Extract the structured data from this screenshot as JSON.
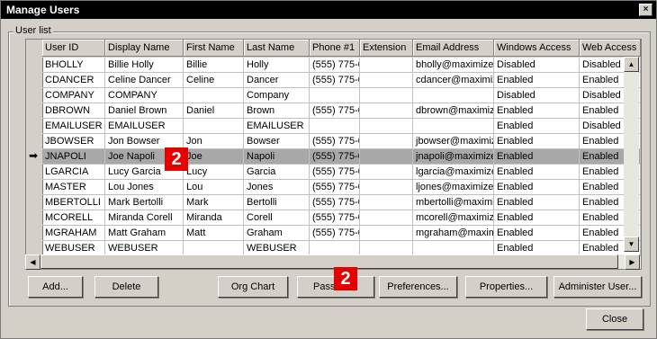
{
  "window": {
    "title": "Manage Users",
    "close_glyph": "×"
  },
  "group": {
    "label": "User list"
  },
  "grid": {
    "columns": [
      "User ID",
      "Display Name",
      "First Name",
      "Last Name",
      "Phone #1",
      "Extension",
      "Email Address",
      "Windows Access",
      "Web Access"
    ],
    "sort_indicator": "/",
    "rows": [
      [
        "BHOLLY",
        "Billie Holly",
        "Billie",
        "Holly",
        "(555) 775-0",
        "",
        "bholly@maximizer.c",
        "Disabled",
        "Disabled"
      ],
      [
        "CDANCER",
        "Celine Dancer",
        "Celine",
        "Dancer",
        "(555) 775-0",
        "",
        "cdancer@maximize",
        "Enabled",
        "Enabled"
      ],
      [
        "COMPANY",
        "COMPANY",
        "",
        "Company",
        "",
        "",
        "",
        "Disabled",
        "Disabled"
      ],
      [
        "DBROWN",
        "Daniel Brown",
        "Daniel",
        "Brown",
        "(555) 775-0",
        "",
        "dbrown@maximizer",
        "Enabled",
        "Enabled"
      ],
      [
        "EMAILUSER",
        "EMAILUSER",
        "",
        "EMAILUSER",
        "",
        "",
        "",
        "Enabled",
        "Disabled"
      ],
      [
        "JBOWSER",
        "Jon Bowser",
        "Jon",
        "Bowser",
        "(555) 775-0",
        "",
        "jbowser@maximize",
        "Enabled",
        "Enabled"
      ],
      [
        "JNAPOLI",
        "Joe Napoli",
        "Joe",
        "Napoli",
        "(555) 775-0",
        "",
        "jnapoli@maximizer.",
        "Enabled",
        "Enabled"
      ],
      [
        "LGARCIA",
        "Lucy Garcia",
        "Lucy",
        "Garcia",
        "(555) 775-0",
        "",
        "lgarcia@maximizer.",
        "Enabled",
        "Enabled"
      ],
      [
        "MASTER",
        "Lou Jones",
        "Lou",
        "Jones",
        "(555) 775-0",
        "",
        "ljones@maximizer.c",
        "Enabled",
        "Enabled"
      ],
      [
        "MBERTOLLI",
        "Mark Bertolli",
        "Mark",
        "Bertolli",
        "(555) 775-0",
        "",
        "mbertolli@maximize",
        "Enabled",
        "Enabled"
      ],
      [
        "MCORELL",
        "Miranda Corell",
        "Miranda",
        "Corell",
        "(555) 775-0",
        "",
        "mcorell@maximizer",
        "Enabled",
        "Enabled"
      ],
      [
        "MGRAHAM",
        "Matt Graham",
        "Matt",
        "Graham",
        "(555) 775-0",
        "",
        "mgraham@maximiz",
        "Enabled",
        "Enabled"
      ],
      [
        "WEBUSER",
        "WEBUSER",
        "",
        "WEBUSER",
        "",
        "",
        "",
        "Enabled",
        "Enabled"
      ]
    ],
    "selected_row_index": 6,
    "selected_marker": "➡"
  },
  "buttons": {
    "add": "Add...",
    "delete": "Delete",
    "org_chart": "Org Chart",
    "password": "Passw",
    "preferences": "Preferences...",
    "properties": "Properties...",
    "administer": "Administer User...",
    "close": "Close"
  },
  "callouts": [
    "2",
    "2"
  ],
  "colors": {
    "callout": "#e60000",
    "title_bar": "#000000",
    "selected_row": "#a8a8a8"
  }
}
